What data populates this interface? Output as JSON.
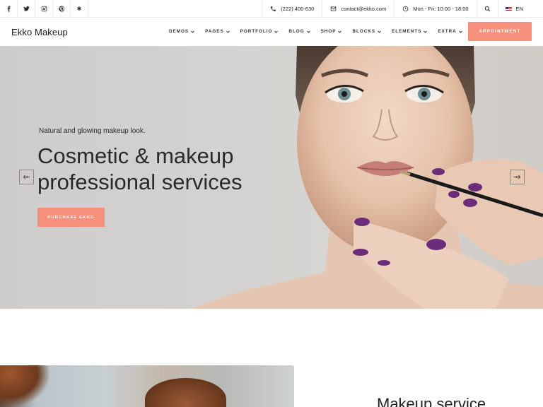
{
  "topbar": {
    "social": [
      "facebook-icon",
      "twitter-icon",
      "instagram-icon",
      "pinterest-icon",
      "yelp-icon"
    ],
    "phone": "(222) 400-630",
    "email": "contact@ekko.com",
    "hours": "Mon - Fri: 10:00 - 18:00",
    "language": "EN"
  },
  "nav": {
    "logo": "Ekko Makeup",
    "items": [
      "DEMOS",
      "PAGES",
      "PORTFOLIO",
      "BLOG",
      "SHOP",
      "BLOCKS",
      "ELEMENTS",
      "EXTRA"
    ],
    "cta": "APPOINTMENT"
  },
  "hero": {
    "kicker": "Natural and glowing makeup look.",
    "headline_line1": "Cosmetic & makeup",
    "headline_line2": "professional services",
    "button": "PURCHASE EKKO"
  },
  "section2": {
    "title": "Makeup service"
  },
  "colors": {
    "accent": "#f6907c",
    "nail": "#6b2c7a"
  }
}
